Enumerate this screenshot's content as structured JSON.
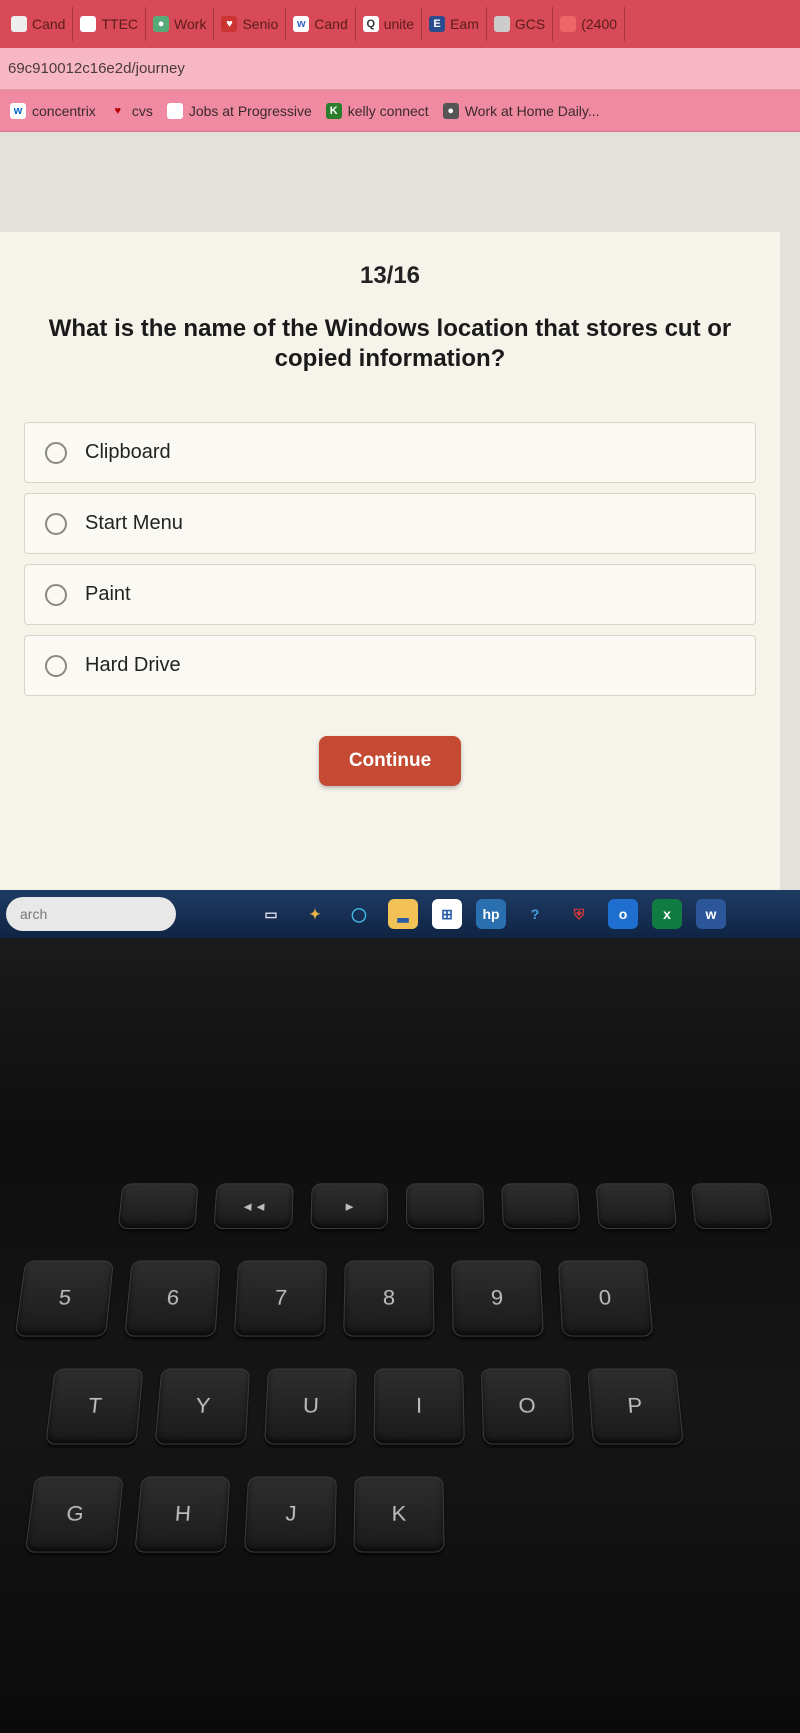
{
  "tabs": [
    {
      "label": "Cand",
      "favicon_bg": "#eee",
      "favicon_fg": "#555",
      "favicon_text": ""
    },
    {
      "label": "TTEC",
      "favicon_bg": "#fff",
      "favicon_fg": "#555",
      "favicon_text": ""
    },
    {
      "label": "Work",
      "favicon_bg": "#5a7",
      "favicon_fg": "#fff",
      "favicon_text": "●"
    },
    {
      "label": "Senio",
      "favicon_bg": "#c33",
      "favicon_fg": "#fff",
      "favicon_text": "♥"
    },
    {
      "label": "Cand",
      "favicon_bg": "#fff",
      "favicon_fg": "#36c",
      "favicon_text": "w"
    },
    {
      "label": "unite",
      "favicon_bg": "#fff",
      "favicon_fg": "#333",
      "favicon_text": "Q"
    },
    {
      "label": "Eam",
      "favicon_bg": "#2a4b8d",
      "favicon_fg": "#fff",
      "favicon_text": "E"
    },
    {
      "label": "GCS",
      "favicon_bg": "#ccc",
      "favicon_fg": "#555",
      "favicon_text": ""
    },
    {
      "label": "(2400",
      "favicon_bg": "#e66",
      "favicon_fg": "#fff",
      "favicon_text": ""
    }
  ],
  "address": {
    "url_fragment": "69c910012c16e2d/journey"
  },
  "bookmarks": [
    {
      "label": "concentrix",
      "ico_bg": "#fff",
      "ico_fg": "#06c",
      "ico_text": "w"
    },
    {
      "label": "cvs",
      "ico_bg": "transparent",
      "ico_fg": "#b00",
      "ico_text": "♥"
    },
    {
      "label": "Jobs at Progressive",
      "ico_bg": "#fff",
      "ico_fg": "#888",
      "ico_text": ""
    },
    {
      "label": "kelly connect",
      "ico_bg": "#2a7d2a",
      "ico_fg": "#fff",
      "ico_text": "K"
    },
    {
      "label": "Work at Home Daily...",
      "ico_bg": "#555",
      "ico_fg": "#fff",
      "ico_text": "●"
    }
  ],
  "quiz": {
    "progress": "13/16",
    "question": "What is the name of the Windows location that stores cut or copied information?",
    "options": [
      "Clipboard",
      "Start Menu",
      "Paint",
      "Hard Drive"
    ],
    "continue_label": "Continue"
  },
  "taskbar": {
    "search_placeholder": "arch",
    "icons": [
      {
        "name": "task-view-icon",
        "bg": "transparent",
        "fg": "#dde",
        "text": "▭"
      },
      {
        "name": "copilot-icon",
        "bg": "transparent",
        "fg": "#e9b24a",
        "text": "✦"
      },
      {
        "name": "edge-icon",
        "bg": "transparent",
        "fg": "#3fb7e4",
        "text": "◯"
      },
      {
        "name": "file-explorer-icon",
        "bg": "#f3c256",
        "fg": "#2a5da8",
        "text": "▂"
      },
      {
        "name": "ms-store-icon",
        "bg": "#fff",
        "fg": "#2a5da8",
        "text": "⊞"
      },
      {
        "name": "hp-icon",
        "bg": "#2a6fb0",
        "fg": "#fff",
        "text": "hp"
      },
      {
        "name": "help-icon",
        "bg": "transparent",
        "fg": "#4aa3e0",
        "text": "?"
      },
      {
        "name": "mcafee-icon",
        "bg": "transparent",
        "fg": "#d73a3a",
        "text": "⛨"
      },
      {
        "name": "outlook-icon",
        "bg": "#1f6fd0",
        "fg": "#fff",
        "text": "o"
      },
      {
        "name": "excel-icon",
        "bg": "#107c41",
        "fg": "#fff",
        "text": "x"
      },
      {
        "name": "word-icon",
        "bg": "#2b579a",
        "fg": "#fff",
        "text": "w"
      }
    ]
  },
  "keyboard": {
    "row_fn": [
      "",
      "◄◄",
      "►",
      "",
      "",
      "",
      ""
    ],
    "row_num": [
      "5",
      "6",
      "7",
      "8",
      "9",
      "0"
    ],
    "row_q": [
      "T",
      "Y",
      "U",
      "I",
      "O",
      "P"
    ],
    "row_a": [
      "G",
      "H",
      "J",
      "K"
    ]
  }
}
